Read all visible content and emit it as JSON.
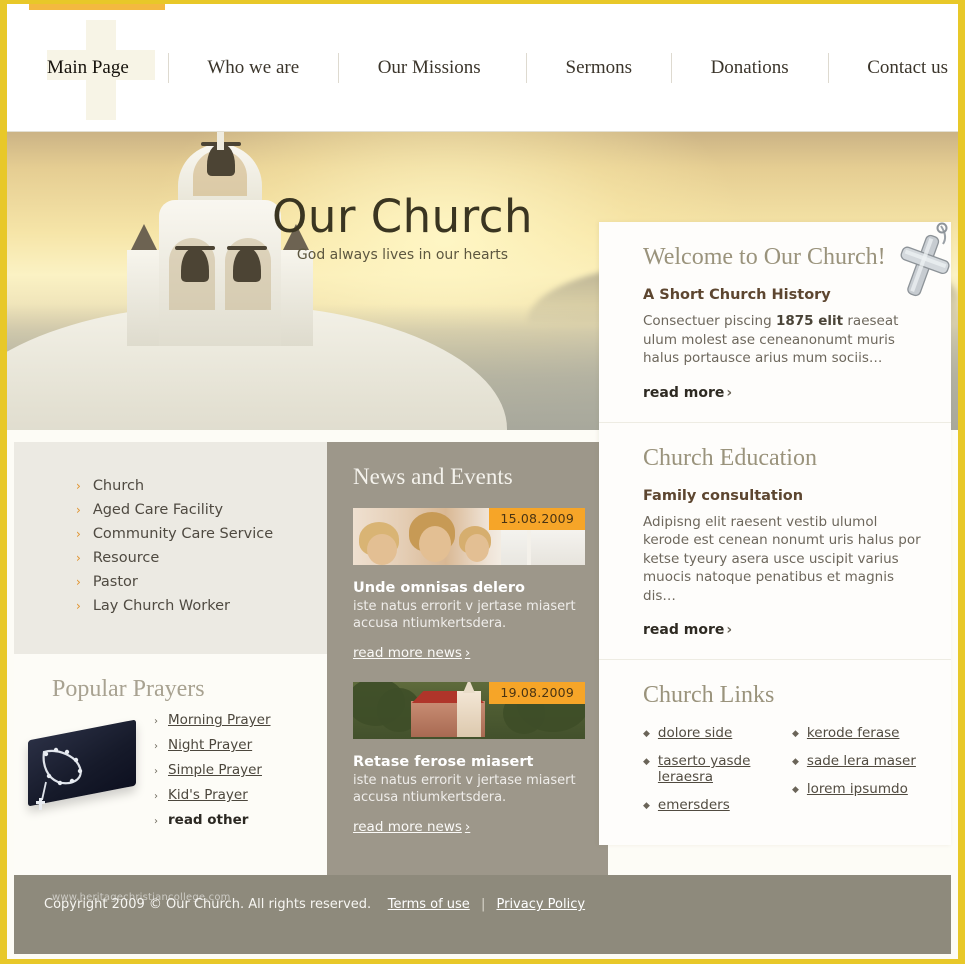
{
  "nav": {
    "items": [
      {
        "label": "Main Page",
        "active": true
      },
      {
        "label": "Who we are",
        "active": false
      },
      {
        "label": "Our Missions",
        "active": false
      },
      {
        "label": "Sermons",
        "active": false
      },
      {
        "label": "Donations",
        "active": false
      },
      {
        "label": "Contact us",
        "active": false
      }
    ]
  },
  "hero": {
    "title": "Our Church",
    "tagline": "God always lives in our hearts",
    "icons": [
      "home-icon",
      "mail-icon",
      "sitemap-icon"
    ]
  },
  "welcome": {
    "heading": "Welcome to Our Church!",
    "subheading": "A Short Church History",
    "body_before": "Consectuer piscing ",
    "body_bold": "1875 elit",
    "body_after": " raeseat ulum molest ase ceneanonumt muris halus portausce arius mum sociis…",
    "read_more": "read more",
    "chevron": "›"
  },
  "education": {
    "heading": "Church Education",
    "subheading": "Family consultation",
    "body": "Adipisng elit raesent vestib ulumol kerode est cenean nonumt uris halus por ketse tyeury asera usce uscipit varius muocis natoque penatibus et magnis dis…",
    "read_more": "read more",
    "chevron": "›"
  },
  "church_links": {
    "heading": "Church Links",
    "bullet": "◆",
    "col_left": [
      "dolore side",
      "taserto yasde leraesra",
      "emersders "
    ],
    "col_right": [
      "kerode ferase",
      "sade lera maser",
      "lorem ipsumdo"
    ]
  },
  "news": {
    "heading": "News and Events",
    "items": [
      {
        "date": "15.08.2009",
        "title": "Unde omnisas delero",
        "body": "iste natus errorit v jertase miasert accusa ntiumkertsdera.",
        "link": "read more news",
        "chevron": "›",
        "image": "children-at-window-photo"
      },
      {
        "date": "19.08.2009",
        "title": "Retase ferose miasert",
        "body": "iste natus errorit v jertase miasert accusa ntiumkertsdera.",
        "link": "read more news",
        "chevron": "›",
        "image": "red-roof-church-photo"
      }
    ]
  },
  "sidebar": {
    "chevron": "›",
    "menu": [
      "Church",
      "Aged Care Facility",
      "Community Care Service",
      "Resource",
      "Pastor",
      "Lay Church Worker"
    ]
  },
  "prayers": {
    "heading": "Popular Prayers",
    "bullet": "›",
    "items": [
      {
        "label": "Morning Prayer",
        "bold": false
      },
      {
        "label": "Night Prayer",
        "bold": false
      },
      {
        "label": "Simple Prayer",
        "bold": false
      },
      {
        "label": "Kid's Prayer",
        "bold": false
      },
      {
        "label": "read other",
        "bold": true
      }
    ]
  },
  "footer": {
    "copyright": "Copyright 2009 © Our Church. All rights reserved.",
    "terms": "Terms of use",
    "separator": "|",
    "privacy": "Privacy Policy",
    "watermark": "www.heritagechristiancollege.com"
  },
  "colors": {
    "frame": "#e8c829",
    "accent_orange": "#f6a528",
    "news_bg": "#9d978a",
    "footer_bg": "#8e8a7c",
    "sidebar_bg": "#eceae3"
  }
}
